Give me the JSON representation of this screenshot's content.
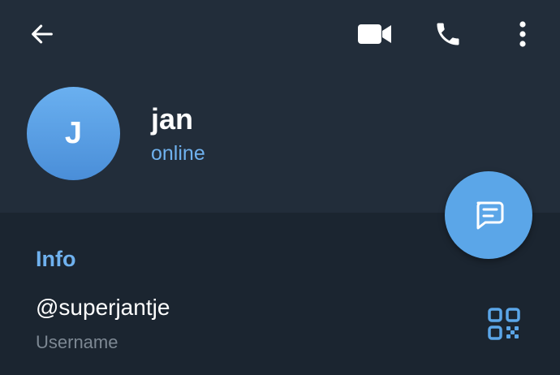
{
  "header": {
    "back_icon": "arrow-left-icon",
    "video_icon": "video-camera-icon",
    "call_icon": "phone-icon",
    "more_icon": "more-vertical-icon"
  },
  "contact": {
    "avatar_initial": "J",
    "name": "jan",
    "status": "online"
  },
  "fab": {
    "icon": "message-icon"
  },
  "info": {
    "section_title": "Info",
    "username_value": "@superjantje",
    "username_caption": "Username",
    "qr_icon": "qr-code-icon"
  },
  "colors": {
    "background": "#1b2530",
    "header_background": "#222d3a",
    "accent": "#6fb1ee",
    "avatar": "#5a9fe3",
    "fab": "#5ba6e8",
    "caption": "#7d8893"
  }
}
